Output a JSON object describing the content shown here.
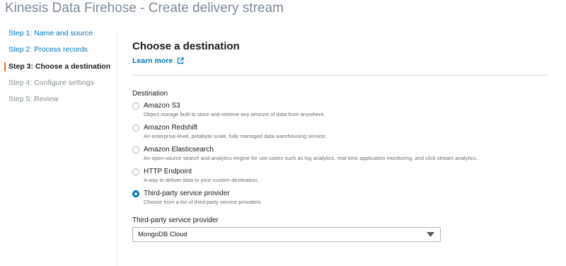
{
  "page": {
    "title": "Kinesis Data Firehose - Create delivery stream"
  },
  "steps": [
    {
      "label": "Step 1: Name and source",
      "state": "link"
    },
    {
      "label": "Step 2: Process records",
      "state": "link"
    },
    {
      "label": "Step 3: Choose a destination",
      "state": "active"
    },
    {
      "label": "Step 4: Configure settings",
      "state": "disabled"
    },
    {
      "label": "Step 5: Review",
      "state": "disabled"
    }
  ],
  "main": {
    "title": "Choose a destination",
    "learn_more": "Learn more",
    "destination_label": "Destination",
    "options": [
      {
        "title": "Amazon S3",
        "desc": "Object storage built to store and retrieve any amount of data from anywhere.",
        "selected": false
      },
      {
        "title": "Amazon Redshift",
        "desc": "An enterprise-level, petabyte scale, fully managed data warehousing service.",
        "selected": false
      },
      {
        "title": "Amazon Elasticsearch",
        "desc": "An open-source search and analytics engine for use cases such as log analytics, real-time application monitoring, and click stream analytics.",
        "selected": false
      },
      {
        "title": "HTTP Endpoint",
        "desc": "A way to deliver data to your custom destination.",
        "selected": false
      },
      {
        "title": "Third-party service provider",
        "desc": "Choose from a list of third-party service providers.",
        "selected": true
      }
    ],
    "third_party_label": "Third-party service provider",
    "third_party_value": "MongoDB Cloud"
  },
  "colors": {
    "link": "#0073bb",
    "active_marker": "#ec7211",
    "radio_selected": "#0073bb"
  },
  "icons": {
    "external_link": "external-link-icon",
    "dropdown": "caret-down-icon"
  }
}
